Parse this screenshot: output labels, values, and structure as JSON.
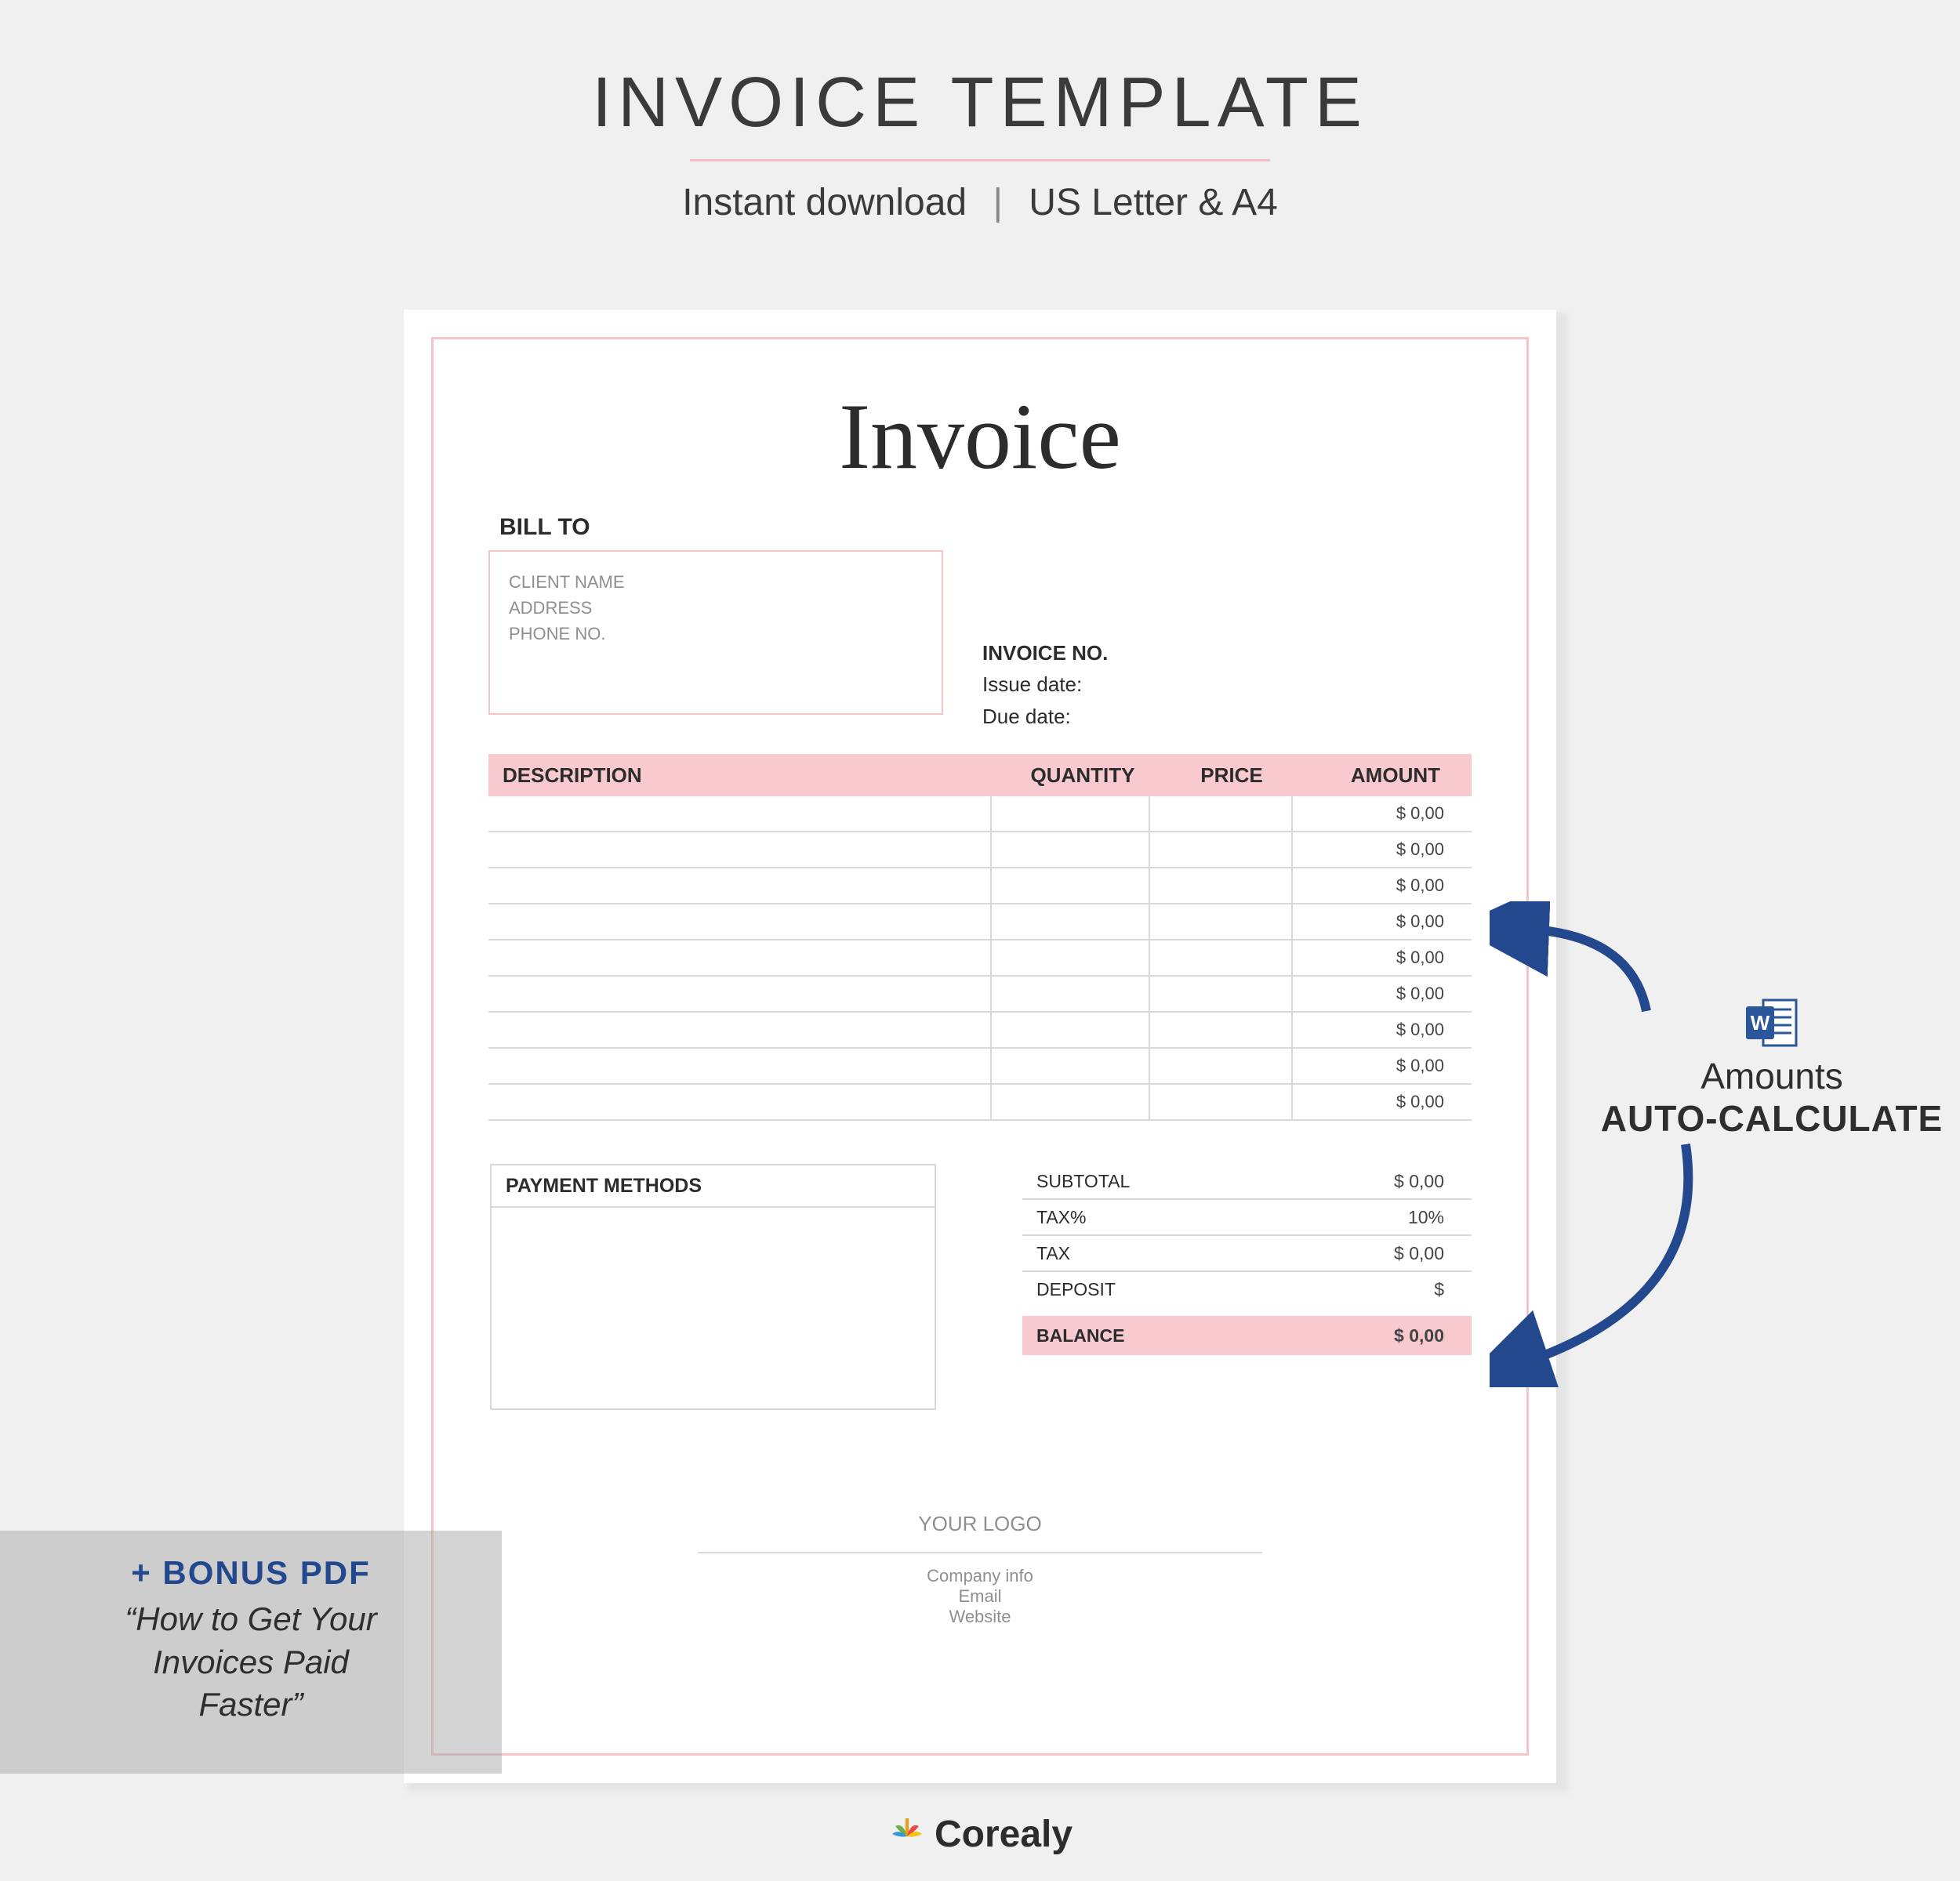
{
  "header": {
    "title": "INVOICE TEMPLATE",
    "sub_left": "Instant download",
    "sub_right": "US Letter & A4",
    "separator": "|"
  },
  "invoice": {
    "title": "Invoice",
    "bill_to_label": "BILL TO",
    "bill_to_lines": [
      "CLIENT NAME",
      "ADDRESS",
      "PHONE NO."
    ],
    "meta": {
      "invoice_no_label": "INVOICE NO.",
      "issue_date_label": "Issue date:",
      "due_date_label": "Due date:"
    },
    "columns": {
      "description": "DESCRIPTION",
      "quantity": "QUANTITY",
      "price": "PRICE",
      "amount": "AMOUNT"
    },
    "row_amount_default": "$  0,00",
    "row_count": 9,
    "payment_methods_label": "PAYMENT METHODS",
    "summary": {
      "subtotal_label": "SUBTOTAL",
      "subtotal_value": "$  0,00",
      "taxpct_label": "TAX%",
      "taxpct_value": "10%",
      "tax_label": "TAX",
      "tax_value": "$  0,00",
      "deposit_label": "DEPOSIT",
      "deposit_value": "$",
      "balance_label": "BALANCE",
      "balance_value": "$  0,00"
    },
    "footer": {
      "logo": "YOUR LOGO",
      "company": "Company info",
      "email": "Email",
      "website": "Website"
    }
  },
  "bonus": {
    "headline": "+ BONUS PDF",
    "line1": "“How to Get Your",
    "line2": "Invoices Paid",
    "line3": "Faster”"
  },
  "autocalc": {
    "line1": "Amounts",
    "line2": "AUTO-CALCULATE"
  },
  "brand": {
    "name": "Corealy"
  }
}
